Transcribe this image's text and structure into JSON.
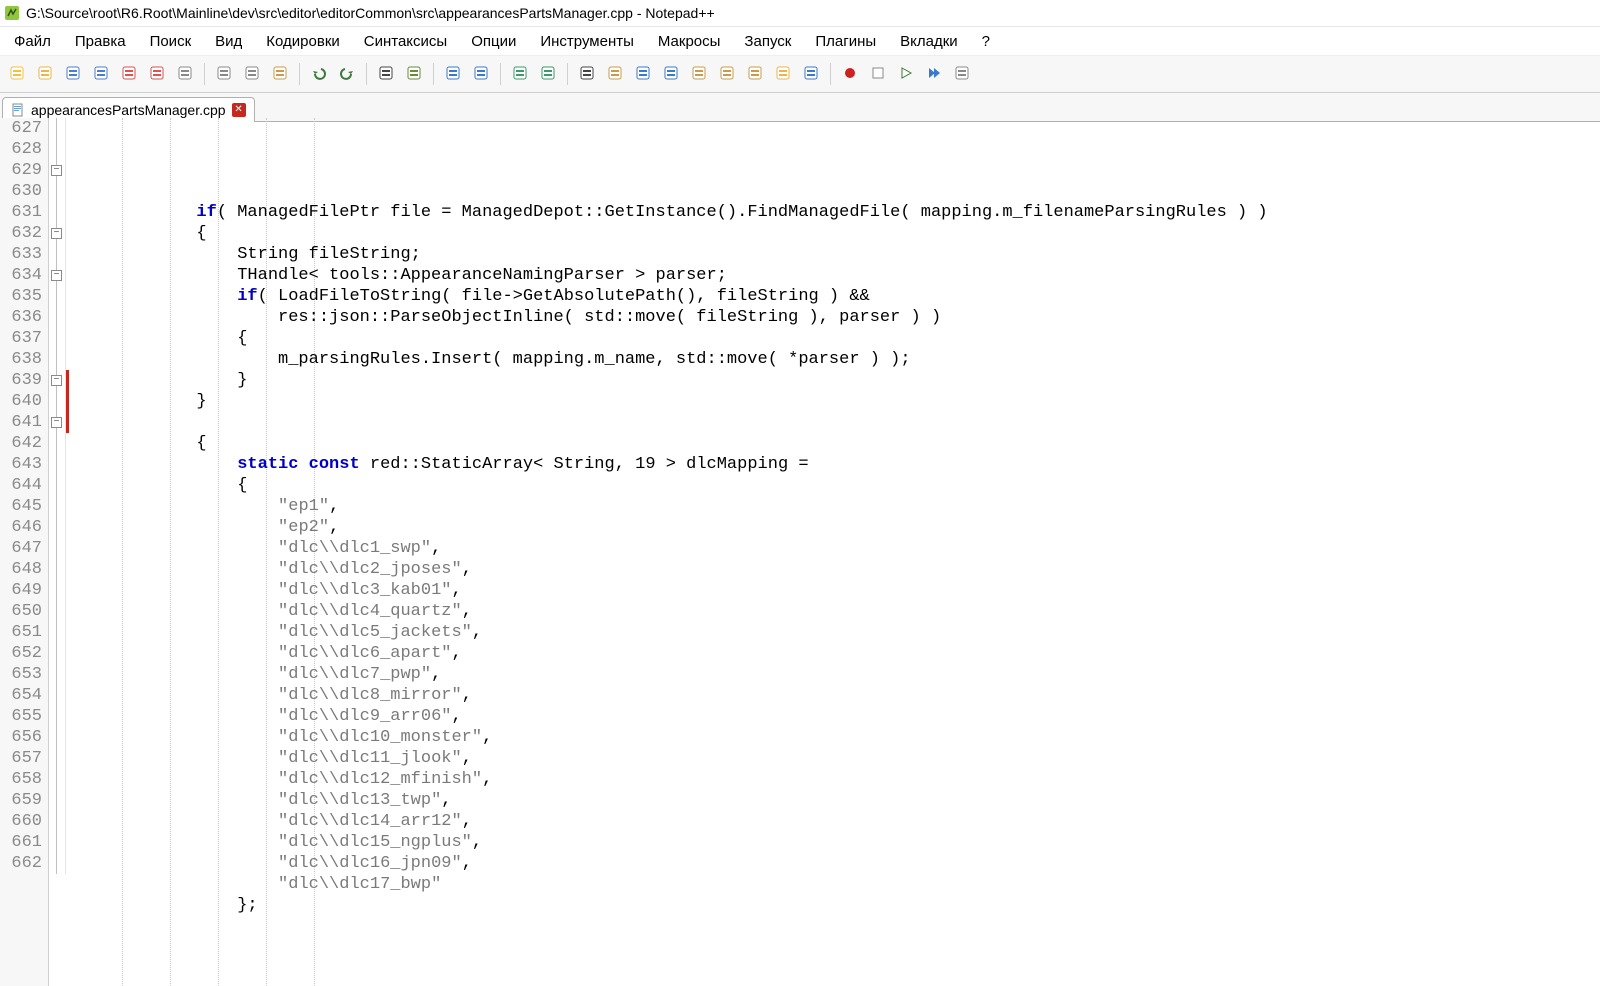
{
  "title": "G:\\Source\\root\\R6.Root\\Mainline\\dev\\src\\editor\\editorCommon\\src\\appearancesPartsManager.cpp - Notepad++",
  "menu": [
    "Файл",
    "Правка",
    "Поиск",
    "Вид",
    "Кодировки",
    "Синтаксисы",
    "Опции",
    "Инструменты",
    "Макросы",
    "Запуск",
    "Плагины",
    "Вкладки",
    "?"
  ],
  "toolbar_icons": [
    "new-file",
    "open-file",
    "save",
    "save-all",
    "close",
    "close-all",
    "print",
    "|",
    "cut",
    "copy",
    "paste",
    "|",
    "undo",
    "redo",
    "|",
    "find",
    "replace",
    "|",
    "zoom-in",
    "zoom-out",
    "|",
    "sync-v",
    "sync-h",
    "|",
    "word-wrap",
    "show-all",
    "indent-guide",
    "fold",
    "user-lang",
    "doc-map",
    "func-list",
    "folder",
    "monitor",
    "|",
    "record",
    "stop",
    "play",
    "play-multi",
    "save-macro"
  ],
  "tab": {
    "label": "appearancesPartsManager.cpp"
  },
  "first_line_no": 627,
  "code_lines": [
    "",
    "            if( ManagedFilePtr file = ManagedDepot::GetInstance().FindManagedFile( mapping.m_filenameParsingRules ) )",
    "            {",
    "                String fileString;",
    "                THandle< tools::AppearanceNamingParser > parser;",
    "                if( LoadFileToString( file->GetAbsolutePath(), fileString ) &&",
    "                    res::json::ParseObjectInline( std::move( fileString ), parser ) )",
    "                {",
    "                    m_parsingRules.Insert( mapping.m_name, std::move( *parser ) );",
    "                }",
    "            }",
    "",
    "            {",
    "                static const red::StaticArray< String, 19 > dlcMapping =",
    "                {",
    "                    \"ep1\",",
    "                    \"ep2\",",
    "                    \"dlc\\\\dlc1_swp\",",
    "                    \"dlc\\\\dlc2_jposes\",",
    "                    \"dlc\\\\dlc3_kab01\",",
    "                    \"dlc\\\\dlc4_quartz\",",
    "                    \"dlc\\\\dlc5_jackets\",",
    "                    \"dlc\\\\dlc6_apart\",",
    "                    \"dlc\\\\dlc7_pwp\",",
    "                    \"dlc\\\\dlc8_mirror\",",
    "                    \"dlc\\\\dlc9_arr06\",",
    "                    \"dlc\\\\dlc10_monster\",",
    "                    \"dlc\\\\dlc11_jlook\",",
    "                    \"dlc\\\\dlc12_mfinish\",",
    "                    \"dlc\\\\dlc13_twp\",",
    "                    \"dlc\\\\dlc14_arr12\",",
    "                    \"dlc\\\\dlc15_ngplus\",",
    "                    \"dlc\\\\dlc16_jpn09\",",
    "                    \"dlc\\\\dlc17_bwp\"",
    "                };",
    ""
  ],
  "fold_marks": [
    {
      "line": 629,
      "kind": "minus"
    },
    {
      "line": 632,
      "kind": "minus"
    },
    {
      "line": 634,
      "kind": "minus"
    },
    {
      "line": 639,
      "kind": "minus"
    },
    {
      "line": 641,
      "kind": "minus"
    }
  ],
  "change_marks": [
    {
      "from": 639,
      "to": 641
    }
  ],
  "indent_cols": [
    0,
    48,
    96,
    144,
    192,
    240
  ]
}
